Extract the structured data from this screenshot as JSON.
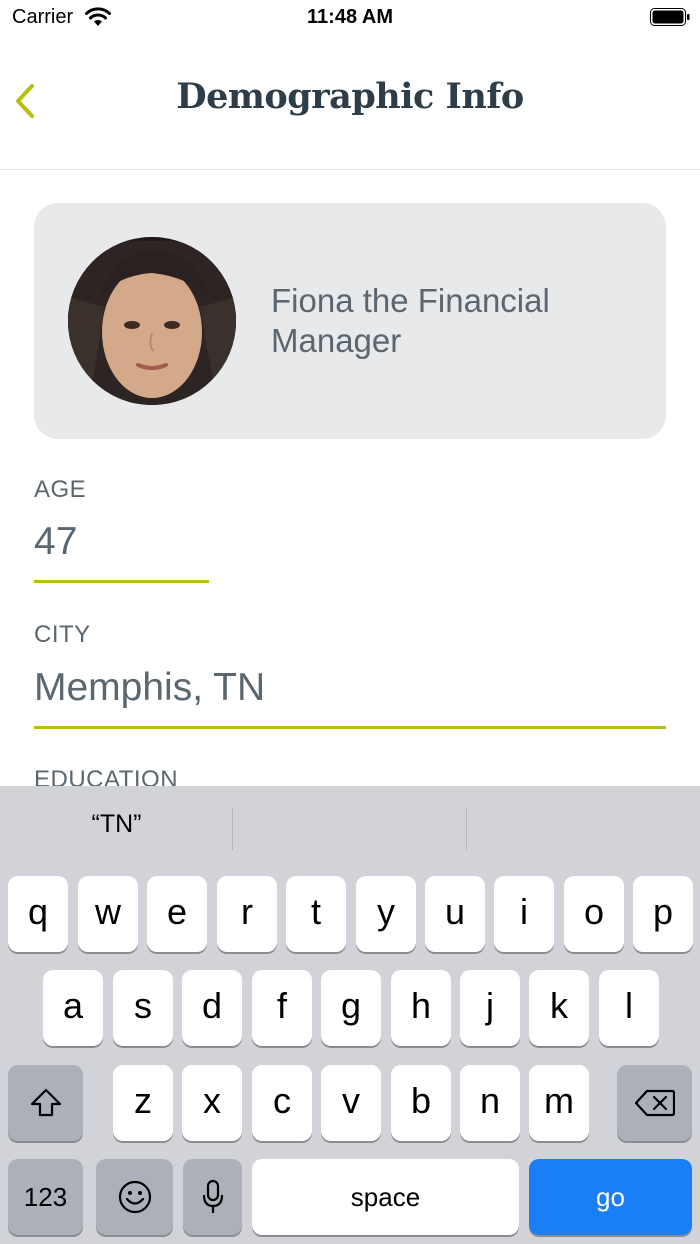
{
  "status": {
    "carrier": "Carrier",
    "time": "11:48 AM"
  },
  "nav": {
    "title": "Demographic Info"
  },
  "profile": {
    "name": "Fiona the Financial Manager"
  },
  "fields": [
    {
      "label": "AGE",
      "value": "47"
    },
    {
      "label": "CITY",
      "value": "Memphis, TN"
    },
    {
      "label": "EDUCATION",
      "value": ""
    }
  ],
  "keyboard": {
    "suggestions": [
      "“TN”",
      "",
      ""
    ],
    "row1": [
      "q",
      "w",
      "e",
      "r",
      "t",
      "y",
      "u",
      "i",
      "o",
      "p"
    ],
    "row2": [
      "a",
      "s",
      "d",
      "f",
      "g",
      "h",
      "j",
      "k",
      "l"
    ],
    "row3": [
      "z",
      "x",
      "c",
      "v",
      "b",
      "n",
      "m"
    ],
    "numbers_label": "123",
    "space_label": "space",
    "go_label": "go"
  },
  "colors": {
    "accent": "#b7bf10",
    "title": "#2e3d47",
    "text": "#5b6770",
    "go": "#1a7ff5"
  }
}
